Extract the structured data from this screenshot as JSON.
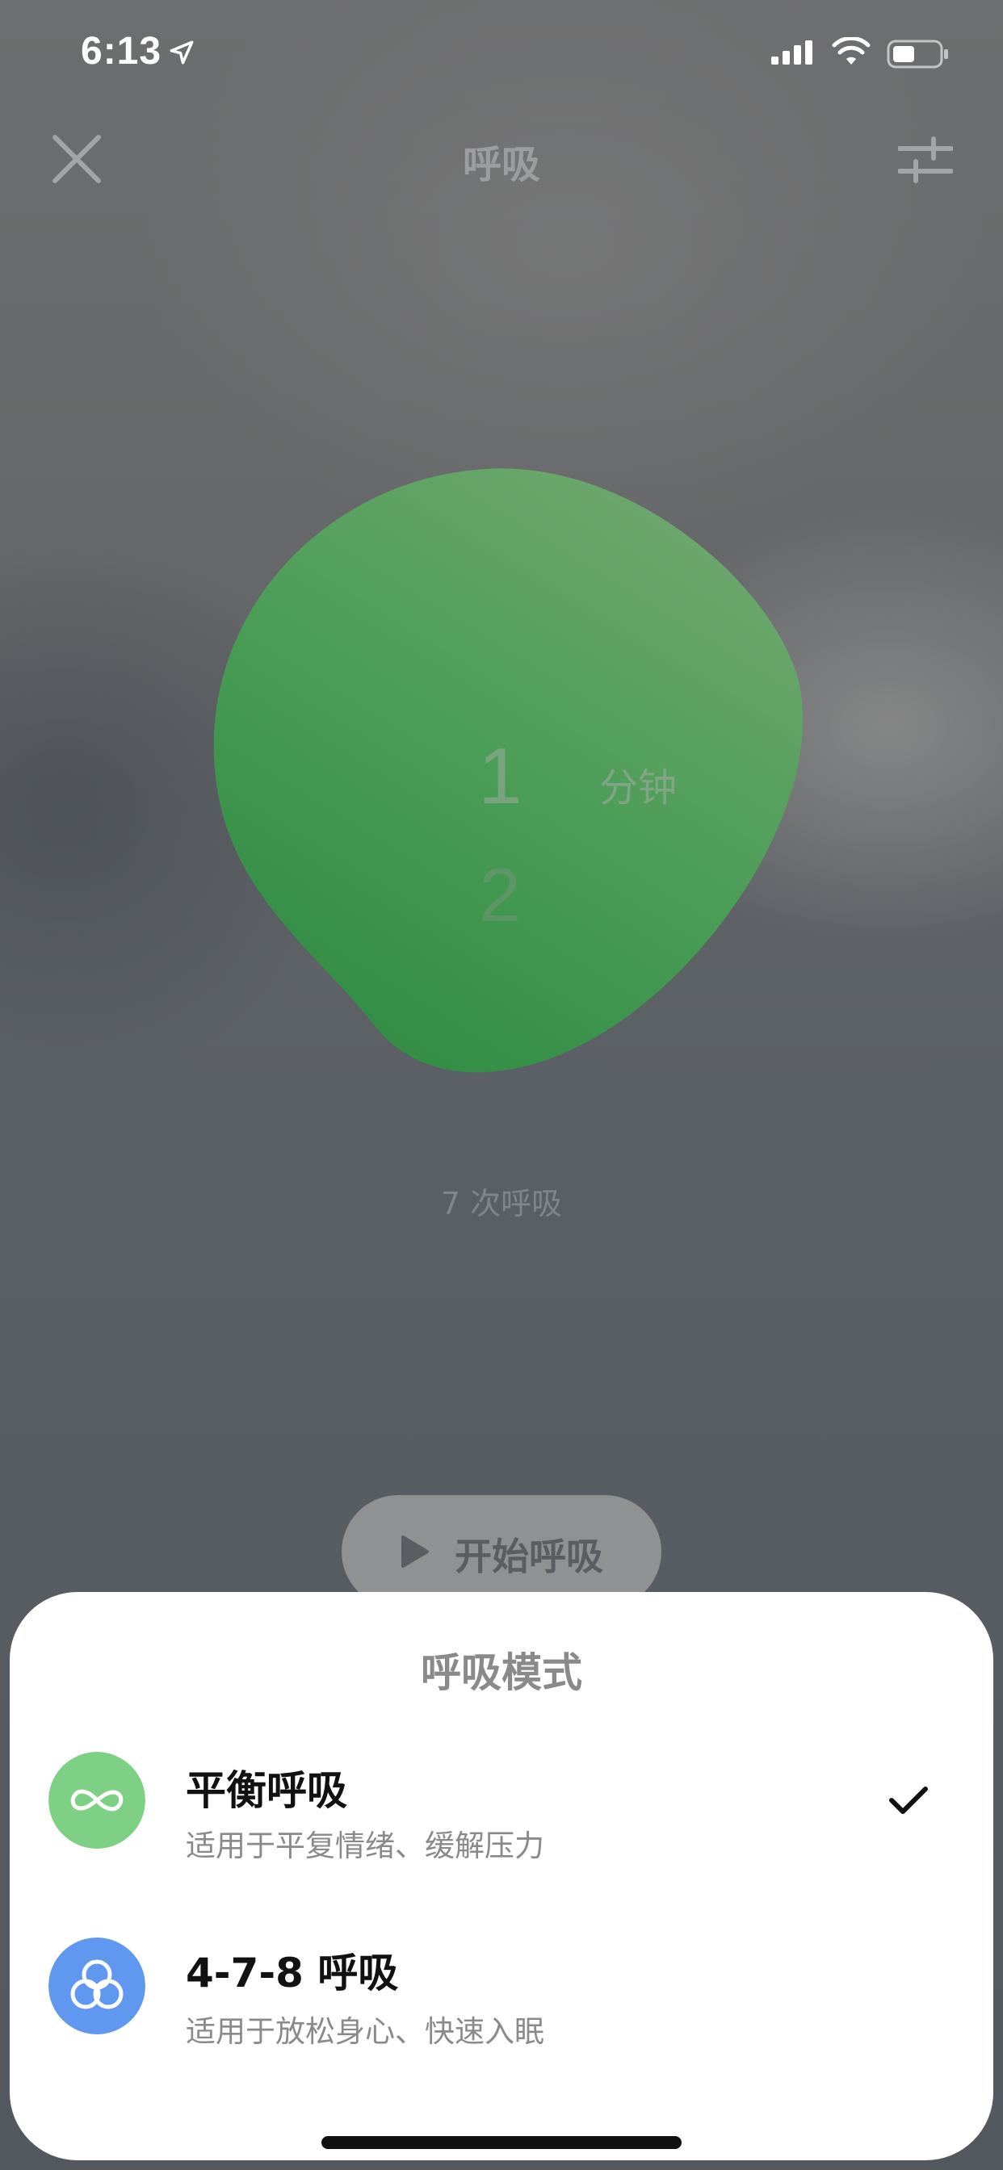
{
  "status_bar": {
    "time": "6:13",
    "icons": [
      "location-arrow-icon",
      "signal-icon",
      "wifi-icon",
      "battery-icon"
    ]
  },
  "nav": {
    "title": "呼吸",
    "close_icon": "close-icon",
    "settings_icon": "sliders-icon"
  },
  "timer": {
    "minute_options": [
      "1",
      "2"
    ],
    "selected_minutes": "1",
    "unit": "分钟",
    "breath_count": "7 次呼吸",
    "blob_color": "#4b9d57"
  },
  "start_button": {
    "label": "开始呼吸",
    "icon": "play-icon"
  },
  "sheet": {
    "title": "呼吸模式",
    "modes": [
      {
        "name": "平衡呼吸",
        "description": "适用于平复情绪、缓解压力",
        "icon": "infinity-icon",
        "icon_color": "#7ed184",
        "selected": true
      },
      {
        "name": "4-7-8 呼吸",
        "description": "适用于放松身心、快速入眠",
        "icon": "rings-icon",
        "icon_color": "#5f98ee",
        "selected": false
      }
    ]
  }
}
